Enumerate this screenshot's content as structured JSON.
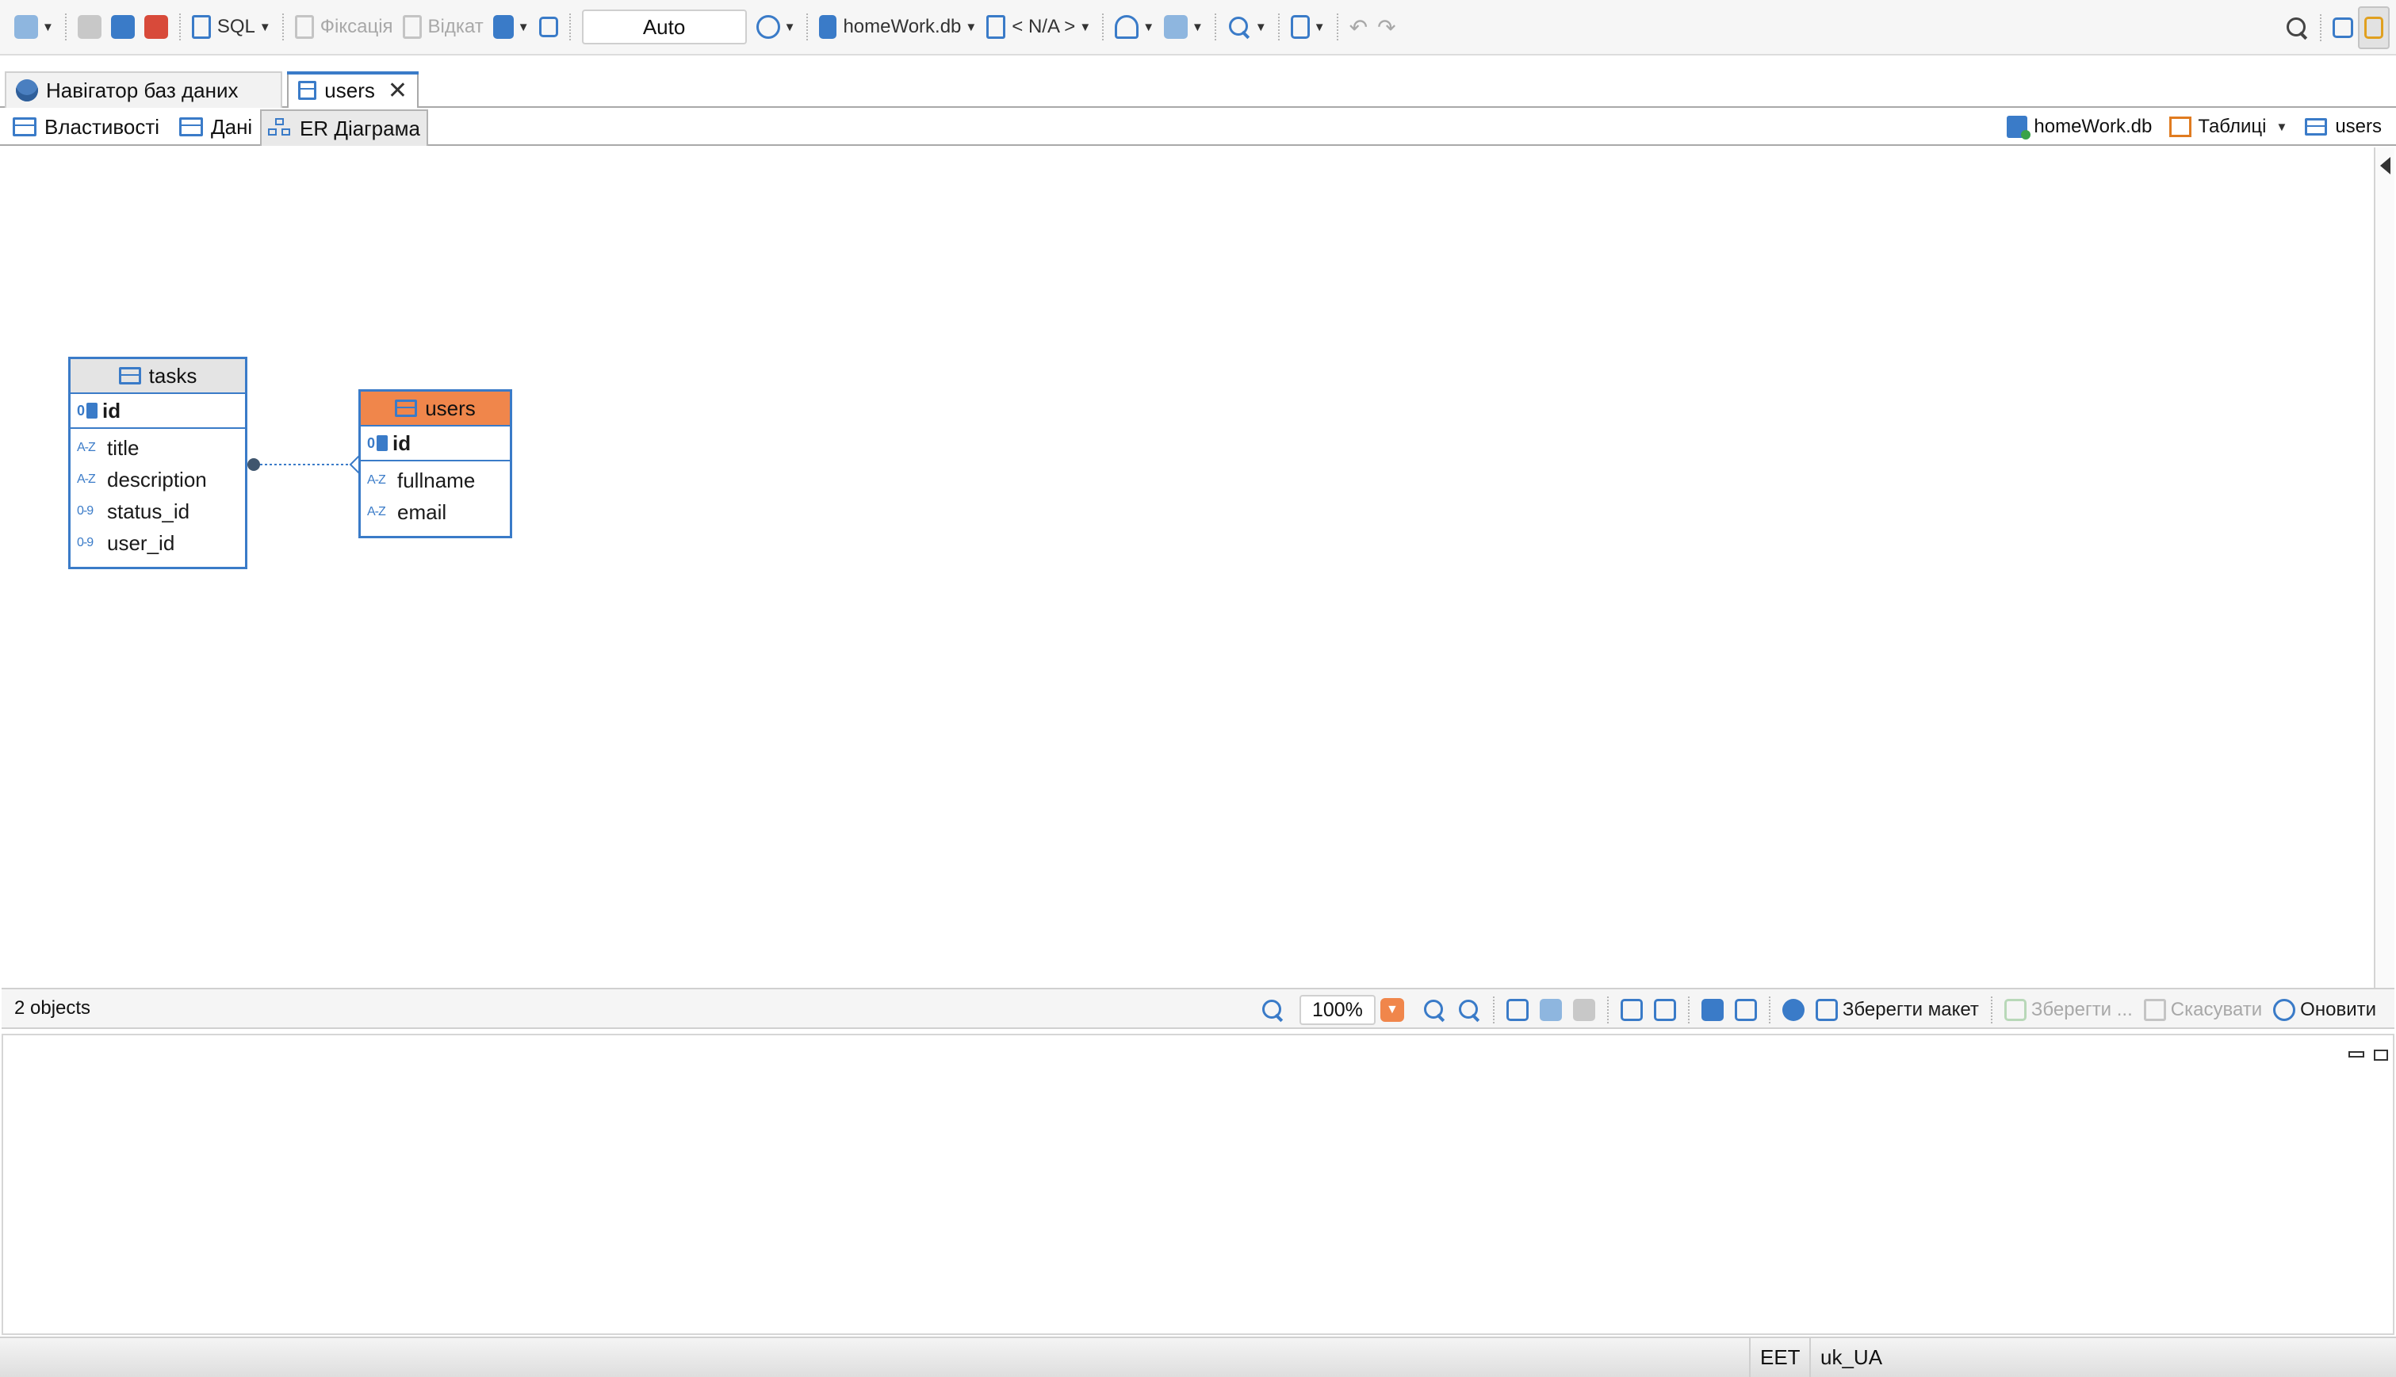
{
  "toolbar": {
    "sql_label": "SQL",
    "commit_label": "Фіксація",
    "rollback_label": "Відкат",
    "transaction_mode": "Auto",
    "datasource_label": "homeWork.db",
    "schema_label": "< N/A >"
  },
  "tabs": {
    "navigator_label": "Навігатор баз даних",
    "users_label": "users"
  },
  "subtabs": {
    "properties_label": "Властивості",
    "data_label": "Дані",
    "er_label": "ER Діаграма"
  },
  "breadcrumb": {
    "db": "homeWork.db",
    "tables": "Таблиці",
    "table": "users"
  },
  "diagram": {
    "tasks": {
      "name": "tasks",
      "pk": {
        "code": "0",
        "name": "id"
      },
      "attributes": [
        {
          "code": "A-Z",
          "name": "title"
        },
        {
          "code": "A-Z",
          "name": "description"
        },
        {
          "code": "0-9",
          "name": "status_id"
        },
        {
          "code": "0-9",
          "name": "user_id"
        }
      ]
    },
    "users": {
      "name": "users",
      "pk": {
        "code": "0",
        "name": "id"
      },
      "attributes": [
        {
          "code": "A-Z",
          "name": "fullname"
        },
        {
          "code": "A-Z",
          "name": "email"
        }
      ]
    }
  },
  "status": {
    "objects": "2 objects",
    "zoom": "100%",
    "save_layout": "Зберегти макет",
    "save": "Зберегти ...",
    "cancel": "Скасувати",
    "refresh": "Оновити"
  },
  "window_status": {
    "timezone": "EET",
    "locale": "uk_UA"
  },
  "colors": {
    "accent": "#3a7bc8",
    "selected_entity": "#f0864b",
    "entity_header": "#e4e4e4"
  }
}
